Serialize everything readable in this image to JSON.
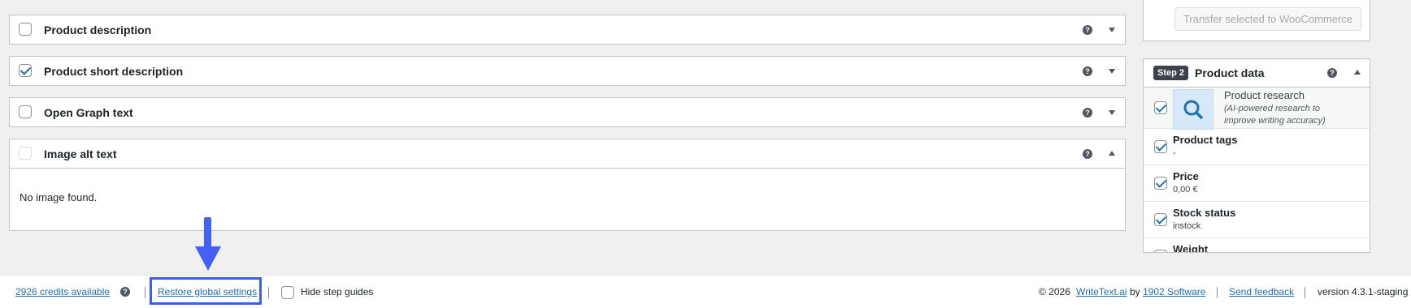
{
  "panels": [
    {
      "title": "Product description",
      "checked": false
    },
    {
      "title": "Product short description",
      "checked": true
    },
    {
      "title": "Open Graph text",
      "checked": false
    },
    {
      "title": "Image alt text",
      "checked": false,
      "disabled": true,
      "expanded": true,
      "body_text": "No image found."
    }
  ],
  "sidebar": {
    "transfer_button": "Transfer selected to WooCommerce",
    "product_data": {
      "step_badge": "Step 2",
      "title": "Product data",
      "research": {
        "title": "Product research",
        "subtitle": "(AI-powered research to improve writing accuracy)",
        "checked": true
      },
      "fields": [
        {
          "label": "Product tags",
          "value": "-",
          "checked": true
        },
        {
          "label": "Price",
          "value": "0,00 €",
          "checked": true
        },
        {
          "label": "Stock status",
          "value": "instock",
          "checked": true
        },
        {
          "label": "Weight",
          "value": "",
          "checked": true
        }
      ]
    }
  },
  "footer": {
    "credits": "2926 credits available",
    "restore": "Restore global settings",
    "hide_guides": "Hide step guides",
    "copyright": "© 2026",
    "brand_link": "WriteText.ai",
    "by": "by",
    "company_link": "1902 Software",
    "feedback": "Send feedback",
    "version": "version 4.3.1-staging"
  },
  "help_symbol": "?",
  "colors": {
    "accent": "#2271b1",
    "annotation": "#3d5cf2",
    "badge": "#3c434a"
  }
}
